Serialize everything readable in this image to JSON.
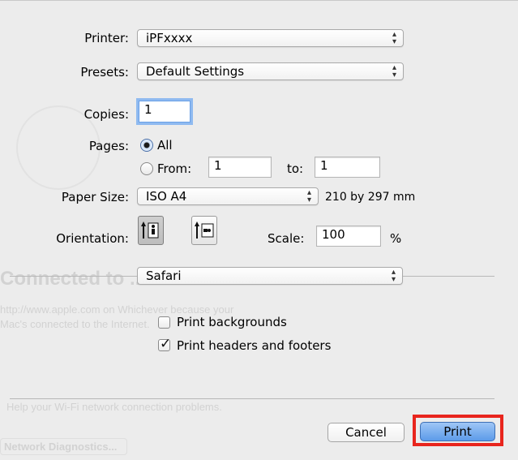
{
  "background_text": {
    "heading": "Connected to ...",
    "line1": "http://www.apple.com on Whichever because your",
    "line2": "Mac's connected to the Internet.",
    "help": "Help your Wi-Fi network connection problems.",
    "button": "Network Diagnostics..."
  },
  "printer": {
    "label": "Printer:",
    "value": "iPFxxxx"
  },
  "presets": {
    "label": "Presets:",
    "value": "Default Settings"
  },
  "copies": {
    "label": "Copies:",
    "value": "1"
  },
  "pages": {
    "label": "Pages:",
    "all_label": "All",
    "from_label": "From:",
    "from_value": "1",
    "to_label": "to:",
    "to_value": "1",
    "selected": "All"
  },
  "paper_size": {
    "label": "Paper Size:",
    "value": "ISO A4",
    "dimensions": "210 by 297 mm"
  },
  "orientation": {
    "label": "Orientation:",
    "selected": "portrait"
  },
  "scale": {
    "label": "Scale:",
    "value": "100",
    "unit": "%"
  },
  "app_menu": {
    "value": "Safari"
  },
  "options": {
    "print_backgrounds": {
      "label": "Print backgrounds",
      "checked": false
    },
    "print_headers_footers": {
      "label": "Print headers and footers",
      "checked": true
    }
  },
  "buttons": {
    "cancel": "Cancel",
    "print": "Print"
  },
  "colors": {
    "highlight": "#e8251d",
    "default_button": "#5c9be9",
    "focus_ring": "#8fbaf0"
  },
  "icons": {
    "popup_arrows": "updown-arrows-icon",
    "portrait": "portrait-orientation-icon",
    "landscape": "landscape-orientation-icon",
    "checkmark": "checkmark-icon"
  }
}
